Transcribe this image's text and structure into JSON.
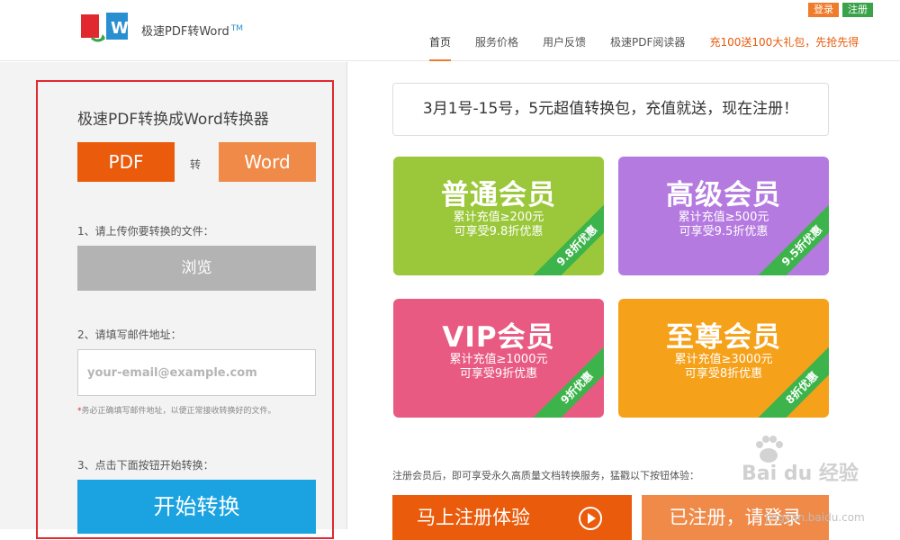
{
  "header": {
    "logo_text": "极速PDF转Word",
    "logo_tm": "TM",
    "login": "登录",
    "register": "注册",
    "nav": [
      {
        "label": "首页"
      },
      {
        "label": "服务价格"
      },
      {
        "label": "用户反馈"
      },
      {
        "label": "极速PDF阅读器"
      },
      {
        "label": "充100送100大礼包，先抢先得"
      }
    ]
  },
  "converter": {
    "title": "极速PDF转换成Word转换器",
    "pdf_label": "PDF",
    "to_label": "转",
    "word_label": "Word",
    "step1": "1、请上传你要转换的文件：",
    "browse": "浏览",
    "step2": "2、请填写邮件地址：",
    "email_placeholder": "your-email@example.com",
    "hint_star": "*",
    "hint": "务必正确填写邮件地址，以便正常接收转换好的文件。",
    "step3": "3、点击下面按钮开始转换：",
    "start": "开始转换"
  },
  "promo": {
    "banner": "3月1号-15号，5元超值转换包，充值就送，现在注册！",
    "cards": [
      {
        "title": "普通会员",
        "line1": "累计充值≥200元",
        "line2": "可享受9.8折优惠",
        "ribbon": "9.8折优惠",
        "color": "#9bc83a"
      },
      {
        "title": "高级会员",
        "line1": "累计充值≥500元",
        "line2": "可享受9.5折优惠",
        "ribbon": "9.5折优惠",
        "color": "#b57ae0"
      },
      {
        "title": "VIP会员",
        "line1": "累计充值≥1000元",
        "line2": "可享受9折优惠",
        "ribbon": "9折优惠",
        "color": "#e85a82"
      },
      {
        "title": "至尊会员",
        "line1": "累计充值≥3000元",
        "line2": "可享受8折优惠",
        "ribbon": "8折优惠",
        "color": "#f5a11a"
      }
    ],
    "footnote": "注册会员后，即可享受永久高质量文档转换服务，猛戳以下按钮体验：",
    "register_cta": "马上注册体验",
    "login_cta": "已注册，请登录"
  },
  "watermark": {
    "brand": "Bai du 经验",
    "url": "jingyan.baidu.com"
  },
  "colors": {
    "accent_orange": "#ea5b0c",
    "accent_blue": "#1aa3e0",
    "highlight_red": "#e0282e",
    "ribbon_green": "#3cb44b"
  }
}
